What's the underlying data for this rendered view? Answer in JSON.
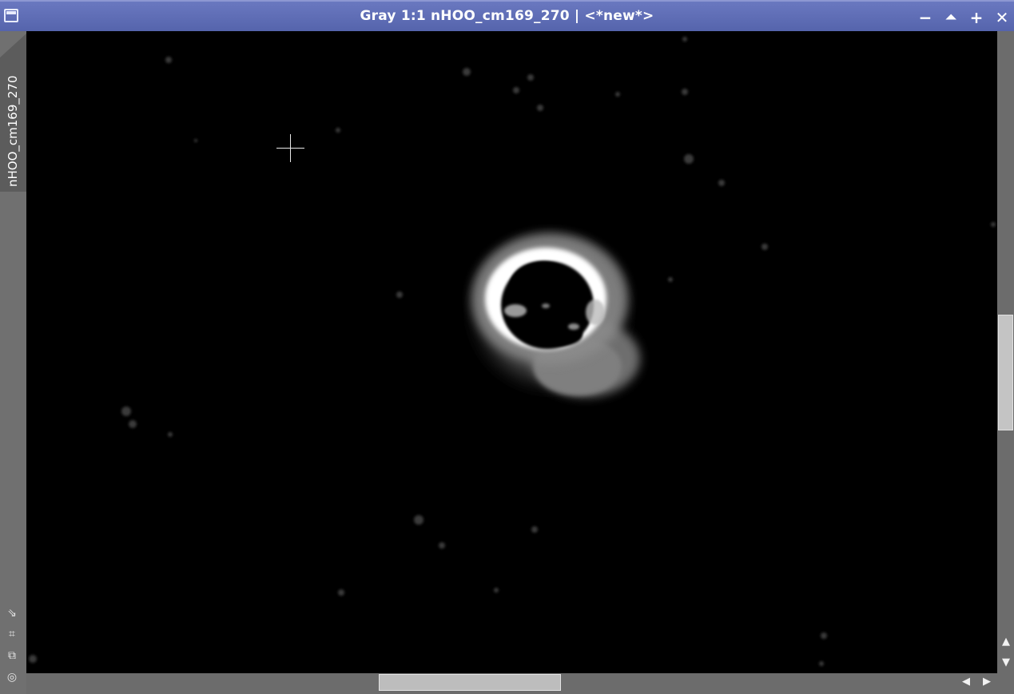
{
  "window": {
    "title": "Gray 1:1 nHOO_cm169_270 | <*new*>",
    "icon": "window-icon",
    "buttons": {
      "minimize_label": "−",
      "shade_label": "⏶",
      "maximize_label": "+",
      "close_label": "✕"
    }
  },
  "side_tab": {
    "label": "nHOO_cm169_270"
  },
  "side_tools": [
    {
      "name": "zoom-fit-icon",
      "glyph": "⇘"
    },
    {
      "name": "crop-icon",
      "glyph": "⌗"
    },
    {
      "name": "clone-icon",
      "glyph": "⧉"
    },
    {
      "name": "target-icon",
      "glyph": "◎"
    }
  ],
  "image": {
    "colors": {
      "background": "#000000",
      "nebula_shell": "#ffffff",
      "nebula_halo": "#8a8a8a"
    }
  },
  "scrollbars": {
    "up_arrow": "▲",
    "down_arrow": "▼",
    "left_arrow": "◀",
    "right_arrow": "▶"
  }
}
